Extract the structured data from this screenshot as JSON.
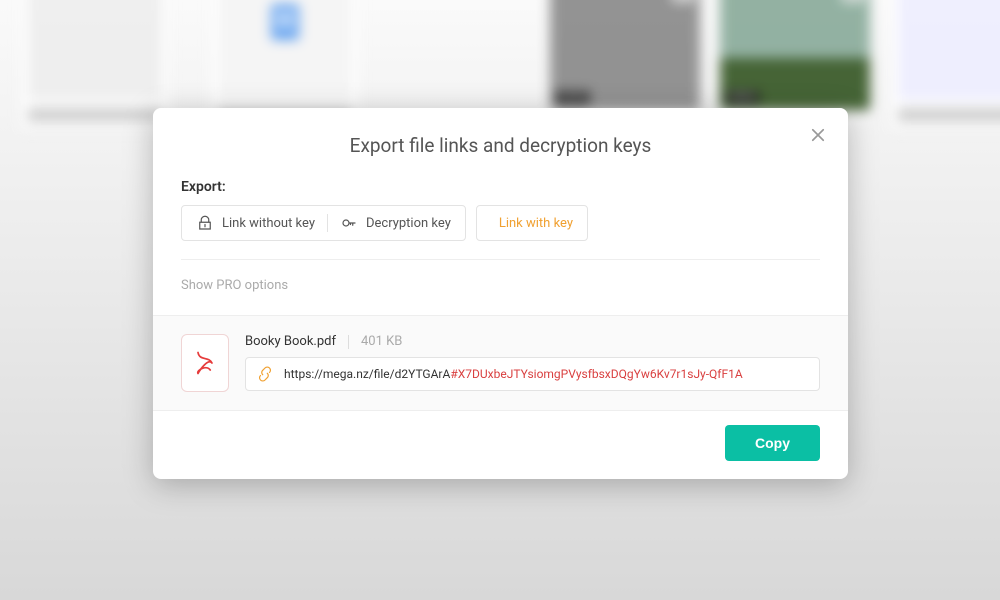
{
  "modal": {
    "title": "Export file links and decryption keys",
    "export_label": "Export:",
    "btn_without_key": "Link without key",
    "btn_decryption_key": "Decryption key",
    "btn_with_key": "Link with key",
    "pro_options": "Show PRO options",
    "copy_label": "Copy"
  },
  "file": {
    "name": "Booky Book.pdf",
    "size": "401 KB",
    "link_base": "https://mega.nz/file/d2YTGArA",
    "link_key": "#X7DUxbeJTYsiomgPVysfbsxDQgYw6Kv7r1sJy-QfF1A"
  },
  "colors": {
    "accent": "#f0a030",
    "copy": "#0bbfa4",
    "key": "#d93f3f"
  }
}
